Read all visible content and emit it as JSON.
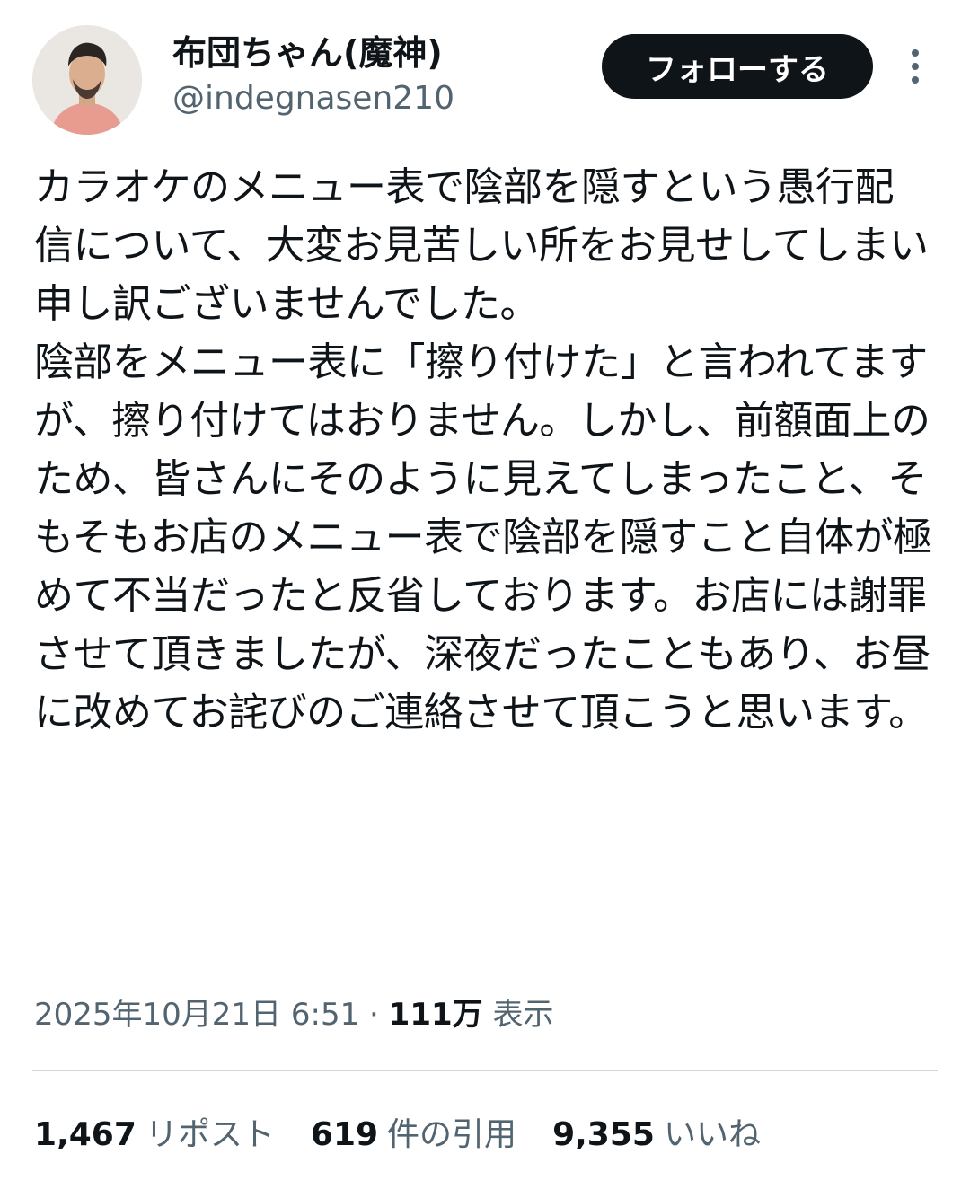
{
  "author": {
    "display_name": "布団ちゃん(魔神)",
    "handle": "@indegnasen210"
  },
  "actions": {
    "follow_label": "フォローする",
    "more_icon": "more-vertical-icon"
  },
  "tweet": {
    "text": "カラオケのメニュー表で陰部を隠すという愚行配信について、大変お見苦しい所をお見せしてしまい申し訳ございませんでした。\n陰部をメニュー表に「擦り付けた」と言われてますが、擦り付けてはおりません。しかし、前額面上のため、皆さんにそのように見えてしまったこと、そもそもお店のメニュー表で陰部を隠すこと自体が極めて不当だったと反省しております。お店には謝罪させて頂きましたが、深夜だったこともあり、お昼に改めてお詫びのご連絡させて頂こうと思います。"
  },
  "meta": {
    "timestamp": "2025年10月21日 6:51",
    "separator": "·",
    "views_count": "111万",
    "views_label": "表示"
  },
  "stats": {
    "reposts_count": "1,467",
    "reposts_label": "リポスト",
    "quotes_count": "619",
    "quotes_label": "件の引用",
    "likes_count": "9,355",
    "likes_label": "いいね"
  },
  "colors": {
    "text_primary": "#0f1419",
    "text_secondary": "#536471",
    "follow_bg": "#0f1419",
    "divider": "#cfd9de"
  }
}
